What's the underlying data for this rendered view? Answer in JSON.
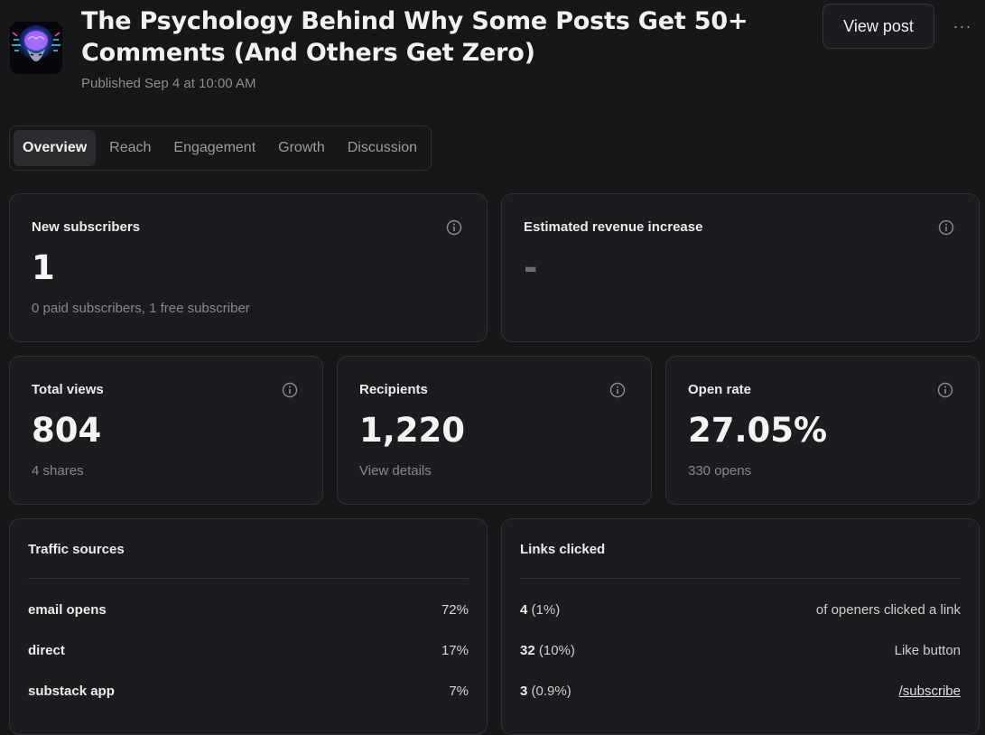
{
  "post": {
    "title": "The Psychology Behind Why Some Posts Get 50+ Comments (And Others Get Zero)",
    "published": "Published Sep 4 at 10:00 AM"
  },
  "header": {
    "view_post_label": "View post",
    "more_label": "···"
  },
  "tabs": [
    {
      "label": "Overview",
      "active": true
    },
    {
      "label": "Reach"
    },
    {
      "label": "Engagement"
    },
    {
      "label": "Growth"
    },
    {
      "label": "Discussion"
    }
  ],
  "cards": {
    "new_subscribers": {
      "label": "New subscribers",
      "value": "1",
      "sub": "0 paid subscribers, 1 free subscriber"
    },
    "revenue": {
      "label": "Estimated revenue increase",
      "value": "-"
    },
    "total_views": {
      "label": "Total views",
      "value": "804",
      "sub": "4 shares"
    },
    "recipients": {
      "label": "Recipients",
      "value": "1,220",
      "sub": "View details"
    },
    "open_rate": {
      "label": "Open rate",
      "value": "27.05%",
      "sub": "330 opens"
    }
  },
  "traffic_sources": {
    "heading": "Traffic sources",
    "rows": [
      {
        "source": "email opens",
        "percent": "72%"
      },
      {
        "source": "direct",
        "percent": "17%"
      },
      {
        "source": "substack app",
        "percent": "7%"
      }
    ]
  },
  "links_clicked": {
    "heading": "Links clicked",
    "rows": [
      {
        "count": "4",
        "pct": "(1%)",
        "target": "of openers clicked a link",
        "is_link": false
      },
      {
        "count": "32",
        "pct": "(10%)",
        "target": "Like button",
        "is_link": false
      },
      {
        "count": "3",
        "pct": "(0.9%)",
        "target": "/subscribe",
        "is_link": true
      }
    ]
  },
  "icons": {
    "info": "info-icon",
    "avatar": "brain-avatar-icon"
  },
  "colors": {
    "background": "#161719",
    "card": "#1b1c1f",
    "border": "#2f3134",
    "muted": "#85878b"
  }
}
